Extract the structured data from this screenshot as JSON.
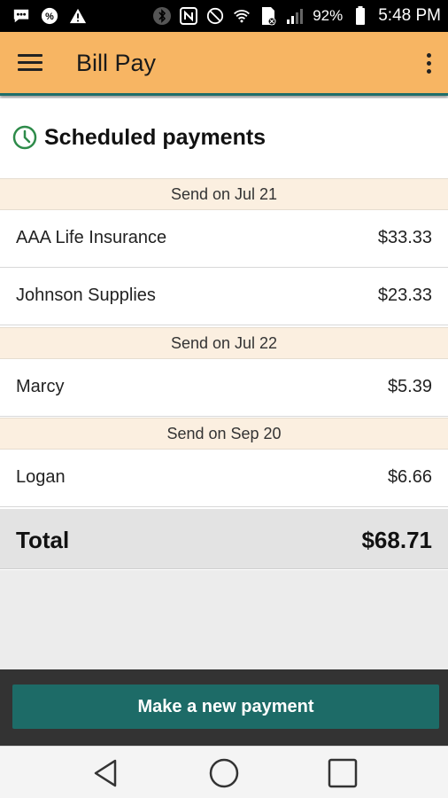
{
  "status_bar": {
    "battery": "92%",
    "time": "5:48 PM",
    "icons": [
      "chat-icon",
      "percent-icon",
      "warning-icon",
      "bluetooth-icon",
      "nfc-icon",
      "do-not-disturb-icon",
      "wifi-icon",
      "sim-icon",
      "signal-icon",
      "battery-icon"
    ]
  },
  "app_bar": {
    "title": "Bill Pay",
    "background": "#f7b563"
  },
  "section": {
    "title": "Scheduled payments"
  },
  "groups": [
    {
      "date_label": "Send on Jul 21",
      "payments": [
        {
          "payee": "AAA Life Insurance",
          "amount": "$33.33"
        },
        {
          "payee": "Johnson Supplies",
          "amount": "$23.33"
        }
      ]
    },
    {
      "date_label": "Send on Jul 22",
      "payments": [
        {
          "payee": "Marcy",
          "amount": "$5.39"
        }
      ]
    },
    {
      "date_label": "Send on Sep 20",
      "payments": [
        {
          "payee": "Logan",
          "amount": "$6.66"
        }
      ]
    }
  ],
  "total": {
    "label": "Total",
    "value": "$68.71"
  },
  "actions": {
    "new_payment_label": "Make a new payment",
    "accent": "#1d6b67"
  },
  "nav": {
    "icons": [
      "back-icon",
      "home-icon",
      "recents-icon"
    ]
  }
}
